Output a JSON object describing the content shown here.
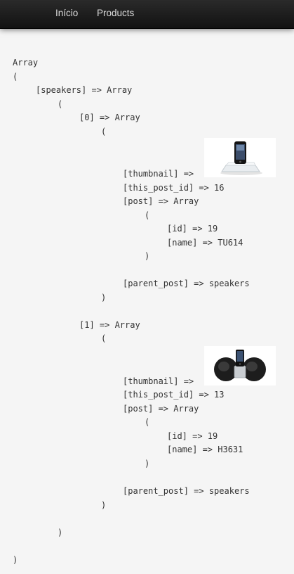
{
  "nav": {
    "items": [
      "Início",
      "Products"
    ]
  },
  "dump": {
    "lines": [
      "Array",
      "(",
      "[speakers] => Array",
      "(",
      "[0] => Array",
      "(",
      "[thumbnail] =>",
      "[this_post_id] => 16",
      "[post] => Array",
      "(",
      "[id] => 19",
      "[name] => TU614",
      ")",
      "[parent_post] => speakers",
      ")",
      "[1] => Array",
      "(",
      "[thumbnail] =>",
      "[this_post_id] => 13",
      "[post] => Array",
      "(",
      "[id] => 19",
      "[name] => H3631",
      ")",
      "[parent_post] => speakers",
      ")",
      ")",
      ")"
    ]
  },
  "images": [
    {
      "alt": "iPhone speaker dock with clear base"
    },
    {
      "alt": "black round speaker dock with iPod"
    }
  ]
}
